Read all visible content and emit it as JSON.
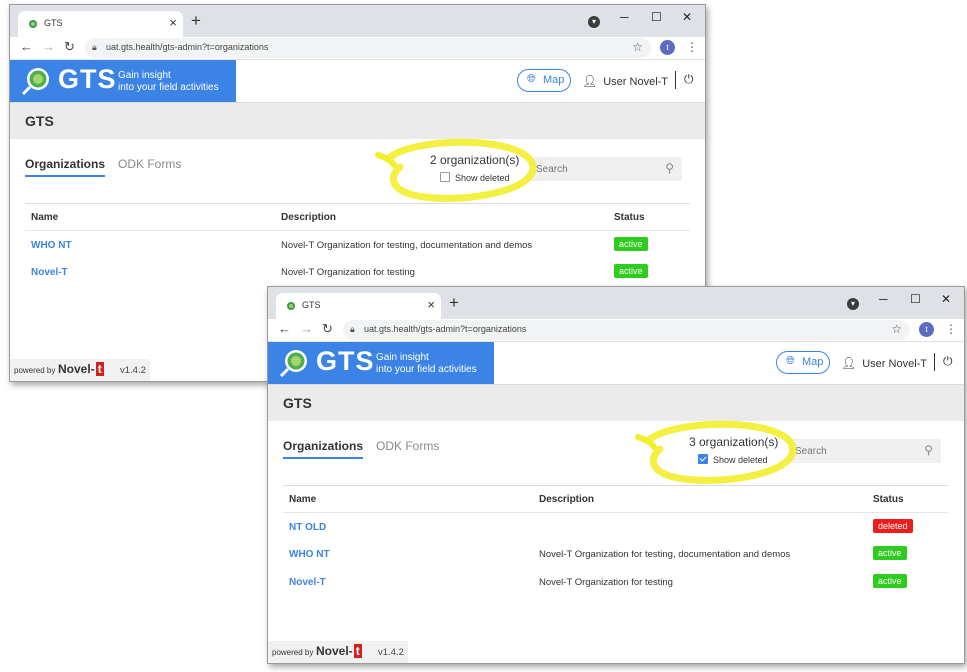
{
  "browser": {
    "tab_title": "GTS",
    "tab_close": "×",
    "new_tab": "+",
    "profile_badge": "t",
    "url": "uat.gts.health/gts-admin?t=organizations",
    "window_controls": [
      "─",
      "☐",
      "✕"
    ]
  },
  "app": {
    "brand_word": "GTS",
    "tagline_line1": "Gain insight",
    "tagline_line2": "into your field activities",
    "map_button": "Map",
    "user_label": "User Novel-T",
    "page_title": "GTS",
    "tab_organizations": "Organizations",
    "tab_odk_forms": "ODK Forms",
    "show_deleted_label": "Show deleted",
    "search_placeholder": "Search",
    "columns": {
      "name": "Name",
      "description": "Description",
      "status": "Status"
    },
    "footer": {
      "powered_by": "powered by",
      "brand": "Novel-",
      "brand_t": "t",
      "version": "v1.4.2"
    },
    "accent_color": "#3c83e6",
    "highlight_color": "#f2ee2c"
  },
  "window1": {
    "count_text": "2 organization(s)",
    "show_deleted_checked": false,
    "rows": [
      {
        "name": "WHO NT",
        "description": "Novel-T Organization for testing, documentation and demos",
        "status": "active"
      },
      {
        "name": "Novel-T",
        "description": "Novel-T Organization for testing",
        "status": "active"
      }
    ]
  },
  "window2": {
    "count_text": "3 organization(s)",
    "show_deleted_checked": true,
    "rows": [
      {
        "name": "NT OLD",
        "description": "",
        "status": "deleted"
      },
      {
        "name": "WHO NT",
        "description": "Novel-T Organization for testing, documentation and demos",
        "status": "active"
      },
      {
        "name": "Novel-T",
        "description": "Novel-T Organization for testing",
        "status": "active"
      }
    ]
  }
}
